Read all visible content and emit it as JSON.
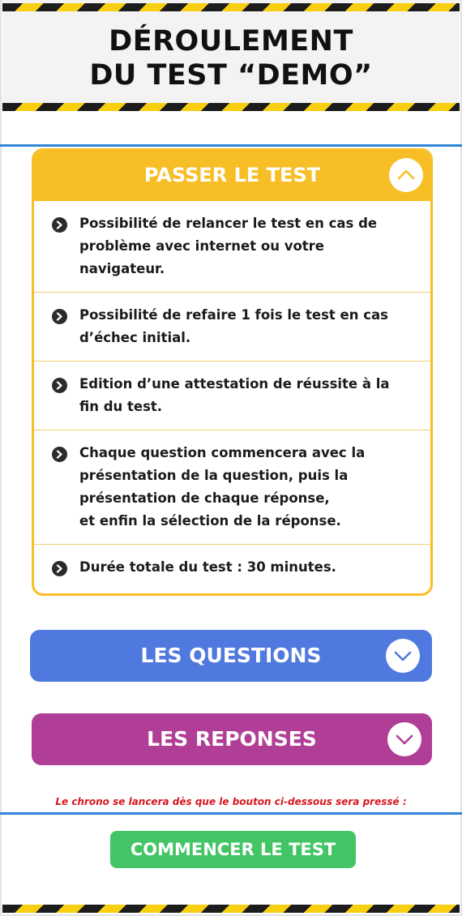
{
  "header": {
    "title_line1": "DÉROULEMENT",
    "title_line2": "DU TEST “DEMO”"
  },
  "accordion": {
    "open_section": {
      "label": "PASSER LE TEST",
      "toggle_icon": "chevron-up-icon",
      "color": "#f8be25",
      "items": [
        "Possibilité de relancer le test en cas de\nproblème avec internet ou votre\nnavigateur.",
        "Possibilité de refaire 1 fois le test en cas\nd’échec initial.",
        "Edition d’une attestation de réussite à la\nfin du test.",
        "Chaque question commencera avec la\nprésentation de la question, puis la\nprésentation de chaque réponse,\net enfin la sélection de la réponse.",
        "Durée totale du test : 30 minutes."
      ],
      "bullet_icon": "chevron-right-circle-icon"
    },
    "questions": {
      "label": "LES QUESTIONS",
      "toggle_icon": "chevron-down-icon",
      "color": "#5079df"
    },
    "reponses": {
      "label": "LES REPONSES",
      "toggle_icon": "chevron-down-icon",
      "color": "#b03e96"
    }
  },
  "notice": "Le chrono se lancera dès que le bouton ci-dessous sera pressé :",
  "start_button": {
    "label": "COMMENCER LE TEST",
    "color": "#44c565"
  }
}
